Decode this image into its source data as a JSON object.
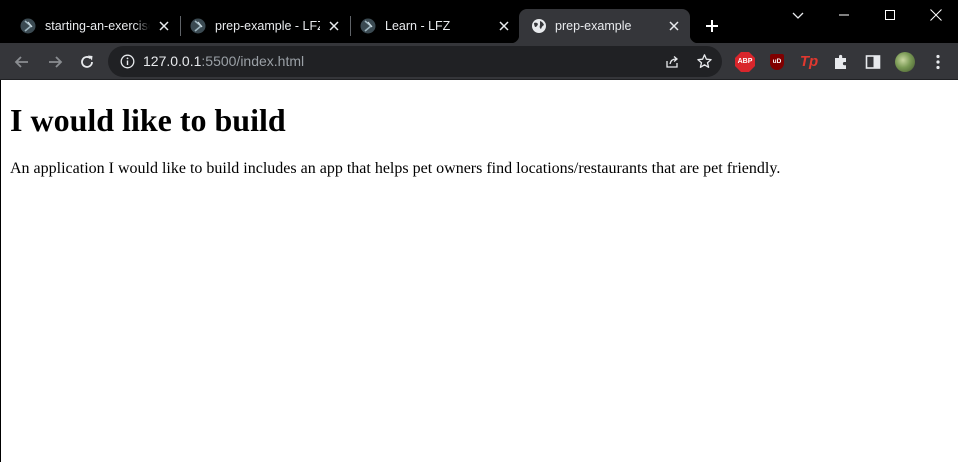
{
  "tabs": [
    {
      "title": "starting-an-exercise",
      "favicon": "lfz-logo-icon",
      "active": false
    },
    {
      "title": "prep-example - LFZ",
      "favicon": "lfz-logo-icon",
      "active": false
    },
    {
      "title": "Learn - LFZ",
      "favicon": "lfz-logo-icon",
      "active": false
    },
    {
      "title": "prep-example",
      "favicon": "globe-icon",
      "active": true
    }
  ],
  "omnibox": {
    "url_host": "127.0.0.1",
    "url_rest": ":5500/index.html"
  },
  "extensions": {
    "abp_label": "ABP",
    "ublock_label": "uD",
    "tp_label": "Tp"
  },
  "page": {
    "heading": "I would like to build",
    "paragraph": "An application I would like to build includes an app that helps pet owners find locations/restaurants that are pet friendly."
  },
  "colors": {
    "tabstrip_bg": "#000000",
    "active_tab_bg": "#35363a",
    "toolbar_bg": "#35363a",
    "omnibox_bg": "#202124",
    "text_light": "#e8eaed",
    "text_muted": "#9aa0a6"
  }
}
